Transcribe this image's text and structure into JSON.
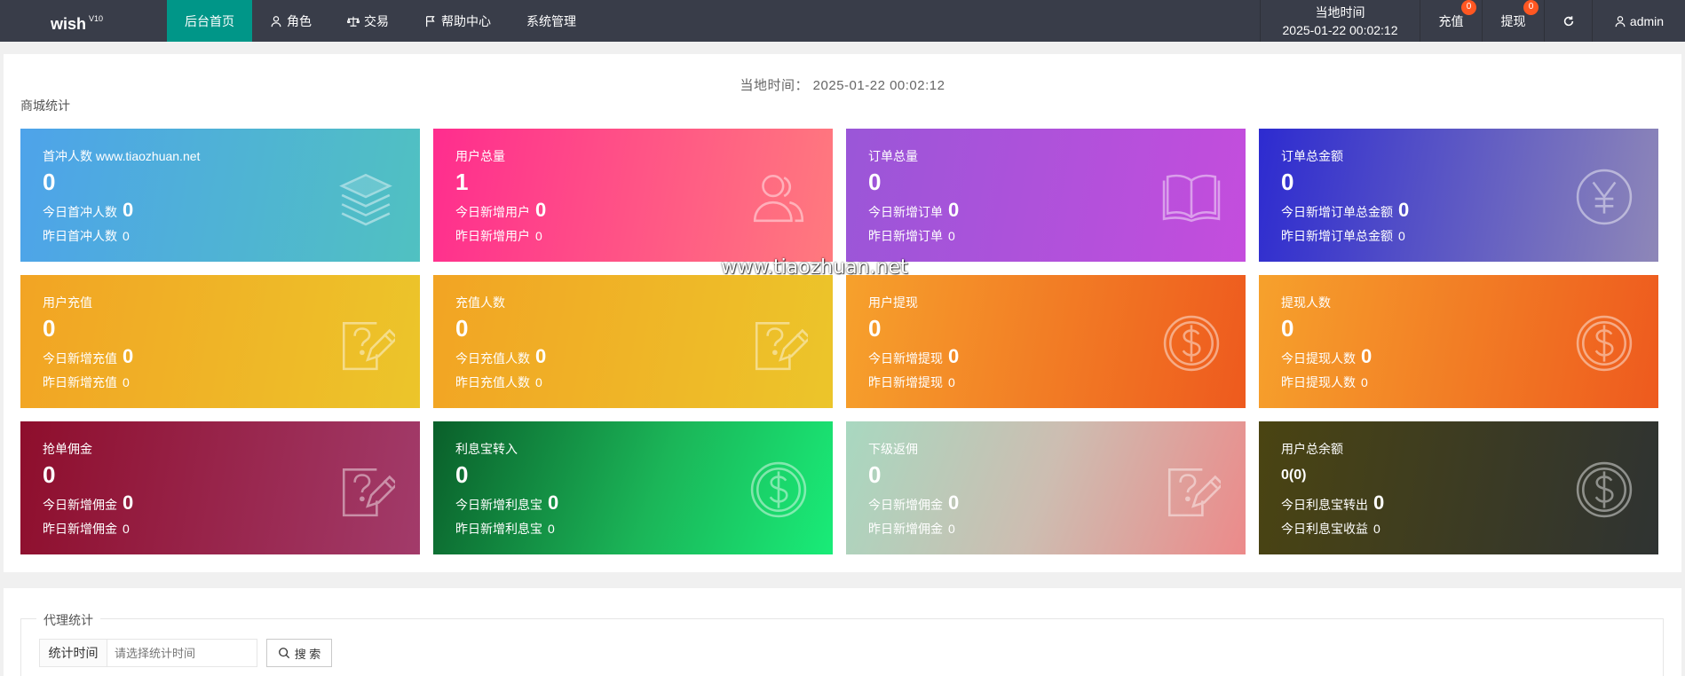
{
  "header": {
    "logo": "wish",
    "version": "V10",
    "nav": [
      {
        "label": "后台首页",
        "icon": "none",
        "active": true
      },
      {
        "label": "角色",
        "icon": "user-icon"
      },
      {
        "label": "交易",
        "icon": "scale-icon"
      },
      {
        "label": "帮助中心",
        "icon": "flag-icon"
      },
      {
        "label": "系统管理",
        "icon": "none"
      }
    ],
    "time_label": "当地时间",
    "time_value": "2025-01-22 00:02:12",
    "charge_label": "充值",
    "charge_badge": "0",
    "withdraw_label": "提现",
    "withdraw_badge": "0",
    "refresh_icon": "refresh-icon",
    "admin_label": "admin",
    "accent_color": "#009688",
    "bar_color": "#393d49",
    "badge_color": "#ff5722"
  },
  "main": {
    "local_time": "当地时间：  2025-01-22 00:02:12",
    "section_title": "商城统计",
    "cards": [
      {
        "title": "首冲人数 www.tiaozhuan.net",
        "value": "0",
        "row1_label": "今日首冲人数",
        "row1_value": "0",
        "row2_label": "昨日首冲人数",
        "row2_value": "0",
        "icon": "layers-icon",
        "gradient": "teal"
      },
      {
        "title": "用户总量",
        "value": "1",
        "row1_label": "今日新增用户",
        "row1_value": "0",
        "row2_label": "昨日新增用户",
        "row2_value": "0",
        "icon": "users-icon",
        "gradient": "pink"
      },
      {
        "title": "订单总量",
        "value": "0",
        "row1_label": "今日新增订单",
        "row1_value": "0",
        "row2_label": "昨日新增订单",
        "row2_value": "0",
        "icon": "book-icon",
        "gradient": "purple"
      },
      {
        "title": "订单总金额",
        "value": "0",
        "row1_label": "今日新增订单总金额",
        "row1_value": "0",
        "row2_label": "昨日新增订单总金额",
        "row2_value": "0",
        "icon": "yen-icon",
        "gradient": "blue"
      },
      {
        "title": "用户充值",
        "value": "0",
        "row1_label": "今日新增充值",
        "row1_value": "0",
        "row2_label": "昨日新增充值",
        "row2_value": "0",
        "icon": "edit-question-icon",
        "gradient": "yellow"
      },
      {
        "title": "充值人数",
        "value": "0",
        "row1_label": "今日充值人数",
        "row1_value": "0",
        "row2_label": "昨日充值人数",
        "row2_value": "0",
        "icon": "edit-question-icon",
        "gradient": "yellow"
      },
      {
        "title": "用户提现",
        "value": "0",
        "row1_label": "今日新增提现",
        "row1_value": "0",
        "row2_label": "昨日新增提现",
        "row2_value": "0",
        "icon": "dollar-icon",
        "gradient": "orange"
      },
      {
        "title": "提现人数",
        "value": "0",
        "row1_label": "今日提现人数",
        "row1_value": "0",
        "row2_label": "昨日提现人数",
        "row2_value": "0",
        "icon": "dollar-icon",
        "gradient": "orange"
      },
      {
        "title": "抢单佣金",
        "value": "0",
        "row1_label": "今日新增佣金",
        "row1_value": "0",
        "row2_label": "昨日新增佣金",
        "row2_value": "0",
        "icon": "edit-question-icon",
        "gradient": "maroon"
      },
      {
        "title": "利息宝转入",
        "value": "0",
        "row1_label": "今日新增利息宝",
        "row1_value": "0",
        "row2_label": "昨日新增利息宝",
        "row2_value": "0",
        "icon": "dollar-icon",
        "gradient": "green"
      },
      {
        "title": "下级返佣",
        "value": "0",
        "row1_label": "今日新增佣金",
        "row1_value": "0",
        "row2_label": "昨日新增佣金",
        "row2_value": "0",
        "icon": "edit-question-icon",
        "gradient": "mint"
      },
      {
        "title": "用户总余额",
        "value": "0(0)",
        "row1_label": "今日利息宝转出",
        "row1_value": "0",
        "row2_label": "今日利息宝收益",
        "row2_value": "0",
        "icon": "dollar-icon",
        "gradient": "olive"
      }
    ],
    "watermark": "www.tiaozhuan.net"
  },
  "agent": {
    "legend": "代理统计",
    "field_label": "统计时间",
    "field_placeholder": "请选择统计时间",
    "search_label": "搜 索"
  }
}
